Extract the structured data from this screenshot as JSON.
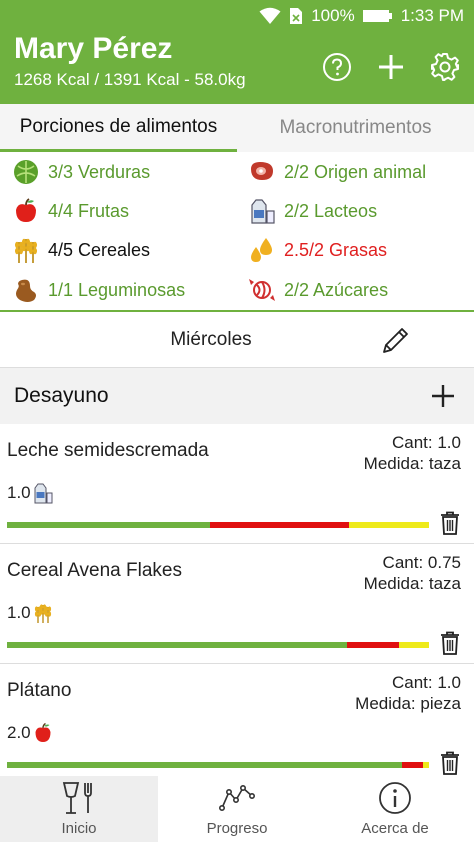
{
  "colors": {
    "accent": "#6fb13f",
    "ok_text": "#5a9a2e",
    "over_text": "#e02020",
    "bar_green": "#6fb13f",
    "bar_red": "#e01010",
    "bar_yellow": "#eeea1a"
  },
  "status_bar": {
    "icons": [
      "wifi-icon",
      "no-sim-icon",
      "battery-icon"
    ],
    "battery": "100%",
    "time": "1:33 PM"
  },
  "header": {
    "title": "Mary Pérez",
    "subtitle": "1268 Kcal / 1391 Kcal - 58.0kg",
    "actions": [
      "help-icon",
      "add-icon",
      "settings-icon"
    ]
  },
  "tabs": [
    {
      "label": "Porciones de alimentos",
      "active": true
    },
    {
      "label": "Macronutrimentos",
      "active": false
    }
  ],
  "portions": [
    {
      "icon": "lettuce-icon",
      "text": "3/3 Verduras",
      "status": "ok"
    },
    {
      "icon": "meat-icon",
      "text": "2/2 Origen animal",
      "status": "ok"
    },
    {
      "icon": "apple-icon",
      "text": "4/4 Frutas",
      "status": "ok"
    },
    {
      "icon": "milk-icon",
      "text": "2/2 Lacteos",
      "status": "ok"
    },
    {
      "icon": "wheat-icon",
      "text": "4/5 Cereales",
      "status": "under"
    },
    {
      "icon": "oil-drops-icon",
      "text": "2.5/2 Grasas",
      "status": "over"
    },
    {
      "icon": "beans-icon",
      "text": "1/1 Leguminosas",
      "status": "ok"
    },
    {
      "icon": "candy-icon",
      "text": "2/2 Azúcares",
      "status": "ok"
    }
  ],
  "day": {
    "label": "Miércoles",
    "edit_icon": "pencil-icon"
  },
  "meal": {
    "title": "Desayuno",
    "add_icon": "add-icon"
  },
  "foods": [
    {
      "name": "Leche semidescremada",
      "cant": "Cant: 1.0",
      "medida": "Medida: taza",
      "portion_value": "1.0",
      "portion_icon": "milk-icon",
      "bar": {
        "green": 0.48,
        "red": 0.33,
        "yellow": 0.19
      }
    },
    {
      "name": "Cereal Avena Flakes",
      "cant": "Cant: 0.75",
      "medida": "Medida: taza",
      "portion_value": "1.0",
      "portion_icon": "wheat-icon",
      "bar": {
        "green": 0.805,
        "red": 0.125,
        "yellow": 0.07
      }
    },
    {
      "name": "Plátano",
      "cant": "Cant: 1.0",
      "medida": "Medida: pieza",
      "portion_value": "2.0",
      "portion_icon": "apple-icon",
      "bar": {
        "green": 0.935,
        "red": 0.05,
        "yellow": 0.015
      }
    }
  ],
  "bottom_nav": [
    {
      "label": "Inicio",
      "icon": "fork-knife-icon",
      "active": true
    },
    {
      "label": "Progreso",
      "icon": "progress-graph-icon",
      "active": false
    },
    {
      "label": "Acerca de",
      "icon": "info-icon",
      "active": false
    }
  ]
}
